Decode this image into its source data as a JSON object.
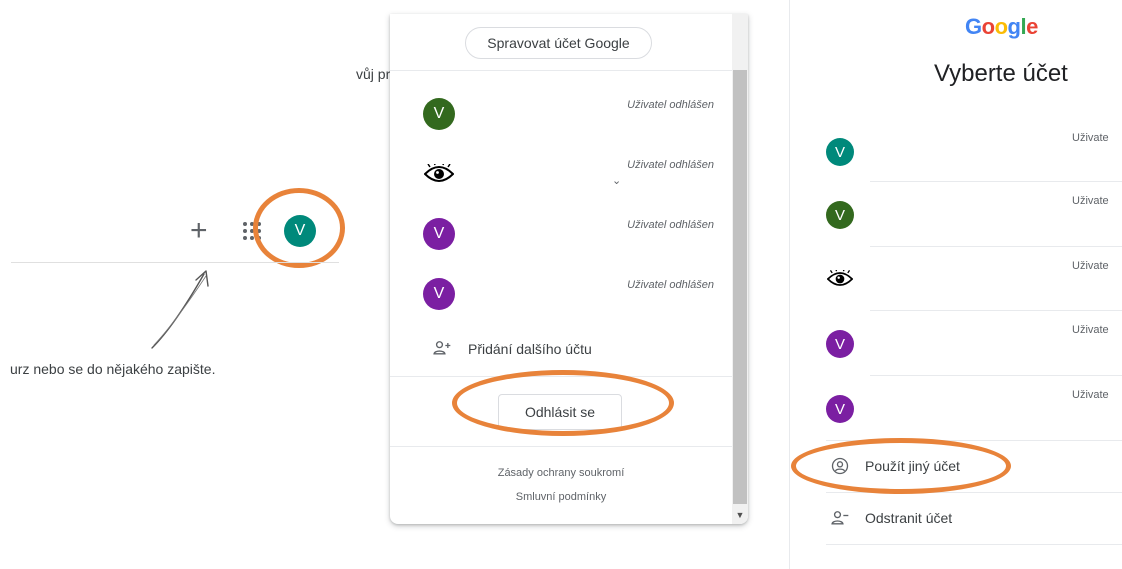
{
  "left": {
    "fragment_top": "vůj pr",
    "fragment_bottom": "urz nebo se do nějakého zapište.",
    "plus_symbol": "+",
    "avatar_letter": "V"
  },
  "popup": {
    "manage_button": "Spravovat účet Google",
    "accounts": [
      {
        "letter": "V",
        "status": "Uživatel odhlášen",
        "color": "#33691e"
      },
      {
        "letter": "",
        "status": "Uživatel odhlášen",
        "icon": "eye-icon"
      },
      {
        "letter": "V",
        "status": "Uživatel odhlášen",
        "color": "#7b1fa2"
      },
      {
        "letter": "V",
        "status": "Uživatel odhlášen",
        "color": "#7b1fa2"
      }
    ],
    "add_account": "Přidání dalšího účtu",
    "sign_out": "Odhlásit se",
    "privacy": "Zásady ochrany soukromí",
    "terms": "Smluvní podmínky"
  },
  "right": {
    "logo": [
      "G",
      "o",
      "o",
      "g",
      "l",
      "e"
    ],
    "title": "Vyberte účet",
    "accounts": [
      {
        "letter": "V",
        "status": "Uživate",
        "color": "#00897b"
      },
      {
        "letter": "V",
        "status": "Uživate",
        "color": "#33691e"
      },
      {
        "letter": "",
        "status": "Uživate",
        "icon": "eye-icon"
      },
      {
        "letter": "V",
        "status": "Uživate",
        "color": "#7b1fa2"
      },
      {
        "letter": "V",
        "status": "Uživate",
        "color": "#7b1fa2"
      }
    ],
    "use_other": "Použít jiný účet",
    "remove": "Odstranit účet"
  },
  "colors": {
    "highlight_ring": "#e8833a",
    "teal_avatar": "#00897b",
    "google_blue": "#4285f4",
    "google_red": "#ea4335",
    "google_yellow": "#fbbc05",
    "google_green": "#34a853"
  }
}
